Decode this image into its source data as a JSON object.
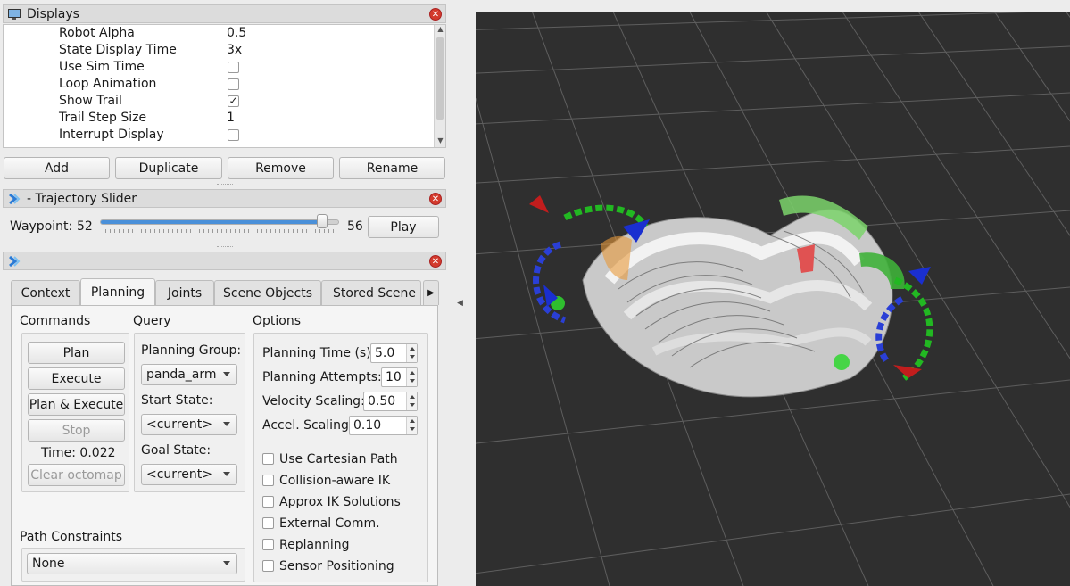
{
  "displays_panel": {
    "title": "Displays",
    "properties": [
      {
        "name": "Robot Alpha",
        "value": "0.5"
      },
      {
        "name": "State Display Time",
        "value": "3x"
      },
      {
        "name": "Use Sim Time",
        "value": "",
        "checked": false
      },
      {
        "name": "Loop Animation",
        "value": "",
        "checked": false
      },
      {
        "name": "Show Trail",
        "value": "",
        "checked": true
      },
      {
        "name": "Trail Step Size",
        "value": "1"
      },
      {
        "name": "Interrupt Display",
        "value": "",
        "checked": false
      }
    ],
    "buttons": {
      "add": "Add",
      "duplicate": "Duplicate",
      "remove": "Remove",
      "rename": "Rename"
    }
  },
  "trajectory_slider": {
    "title": "- Trajectory Slider",
    "waypoint_label": "Waypoint:",
    "current": "52",
    "max": "56",
    "position_fraction": 0.93,
    "play_label": "Play"
  },
  "motion_planning": {
    "tabs": [
      "Context",
      "Planning",
      "Joints",
      "Scene Objects",
      "Stored Scene"
    ],
    "active_tab": "Planning",
    "commands": {
      "label": "Commands",
      "plan": "Plan",
      "execute": "Execute",
      "plan_execute": "Plan & Execute",
      "stop": "Stop",
      "time": "Time: 0.022",
      "clear_octomap": "Clear octomap"
    },
    "query": {
      "label": "Query",
      "planning_group_label": "Planning Group:",
      "planning_group": "panda_arm",
      "start_state_label": "Start State:",
      "start_state": "<current>",
      "goal_state_label": "Goal State:",
      "goal_state": "<current>"
    },
    "options": {
      "label": "Options",
      "planning_time_label": "Planning Time (s):",
      "planning_time": "5.0",
      "planning_attempts_label": "Planning Attempts:",
      "planning_attempts": "10",
      "velocity_scaling_label": "Velocity Scaling:",
      "velocity_scaling": "0.50",
      "accel_scaling_label": "Accel. Scaling:",
      "accel_scaling": "0.10",
      "checkboxes": [
        {
          "label": "Use Cartesian Path",
          "checked": false
        },
        {
          "label": "Collision-aware IK",
          "checked": false
        },
        {
          "label": "Approx IK Solutions",
          "checked": false
        },
        {
          "label": "External Comm.",
          "checked": false
        },
        {
          "label": "Replanning",
          "checked": false
        },
        {
          "label": "Sensor Positioning",
          "checked": false
        }
      ]
    },
    "path_constraints": {
      "label": "Path Constraints",
      "value": "None"
    }
  },
  "colors": {
    "view_background": "#2f2f2f",
    "grid": "#5e5e5e",
    "slider_fill": "#4a90d9",
    "close_button": "#d33a2c"
  }
}
